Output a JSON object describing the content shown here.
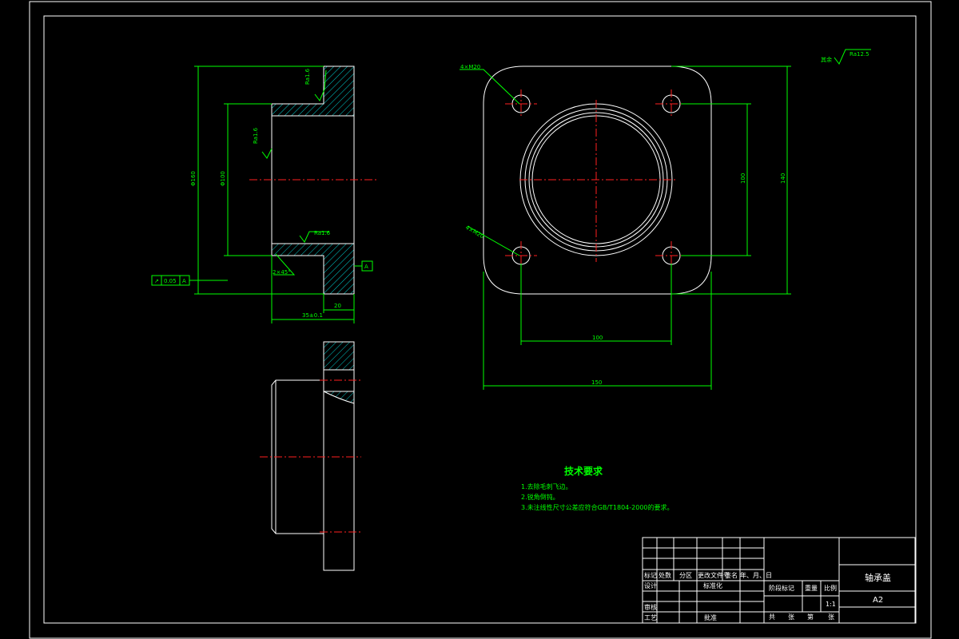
{
  "drawing": {
    "tech_requirements": {
      "title": "技术要求",
      "items": [
        "1.去除毛刺飞边。",
        "2.锐角倒钝。",
        "3.未注线性尺寸公差应符合GB/T1804-2000的要求。"
      ]
    },
    "front_view": {
      "dim_outer_dia": "Φ160",
      "dim_inner_dia": "Φ100",
      "dim_total_width": "35±0.1",
      "dim_flange_width": "20",
      "roughness_1": "Ra1.6",
      "roughness_2": "Ra1.6",
      "roughness_3": "Ra1.6",
      "chamfer": "2×45°",
      "geo_tol": [
        "↗",
        "0.05",
        "A"
      ],
      "datum": "A"
    },
    "plan_view": {
      "hole_callout_1": "4×M20",
      "hole_callout_2": "4×M20",
      "dim_hole_spacing_h": "100",
      "dim_overall_h": "150",
      "dim_hole_spacing_v": "100",
      "dim_overall_v": "140",
      "roughness_rest": "Ra12.5",
      "roughness_rest_label": "其余"
    },
    "title_block": {
      "part_name": "轴承盖",
      "sheet_size": "A2",
      "scale_label": "比例",
      "scale": "1:1",
      "weight_label": "重量",
      "stage_label": "阶段标记",
      "row_labels": [
        "标记",
        "处数",
        "分区",
        "更改文件号",
        "签名",
        "年、月、日"
      ],
      "design": "设计",
      "standardize": "标准化",
      "review": "审核",
      "process": "工艺",
      "approve": "批准",
      "sheet_info": [
        "共",
        "张",
        "第",
        "张"
      ]
    }
  }
}
